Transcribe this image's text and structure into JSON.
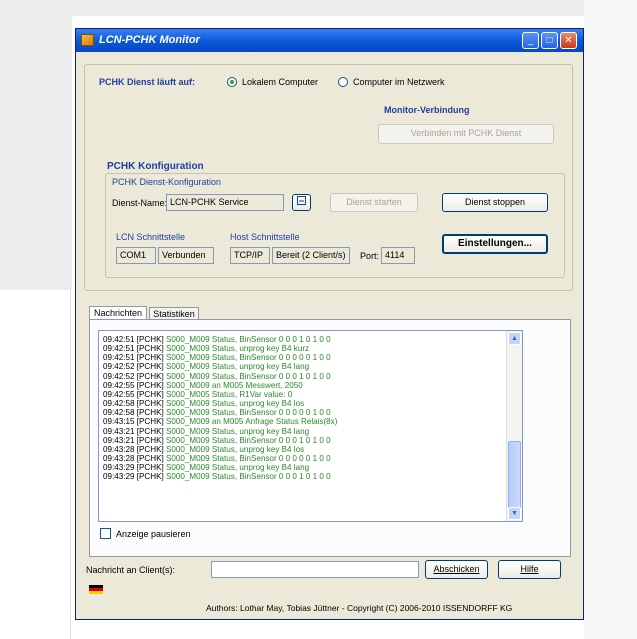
{
  "window": {
    "title": "LCN-PCHK Monitor",
    "minimize_glyph": "_",
    "maximize_glyph": "□",
    "close_glyph": "✕"
  },
  "service": {
    "label": "PCHK Dienst läuft auf:",
    "option_local": "Lokalem Computer",
    "option_network": "Computer im Netzwerk",
    "selected": "Lokalem Computer"
  },
  "monitor": {
    "title": "Monitor-Verbindung",
    "connect_button": "Verbinden mit PCHK Dienst"
  },
  "config": {
    "title": "PCHK Konfiguration",
    "subgroup_label": "PCHK Dienst-Konfiguration",
    "service_name_label": "Dienst-Name:",
    "service_name_value": "LCN-PCHK Service",
    "start_button": "Dienst starten",
    "stop_button": "Dienst stoppen",
    "lcn_label": "LCN Schnittstelle",
    "lcn_port": "COM1",
    "lcn_status": "Verbunden",
    "host_label": "Host Schnittstelle",
    "host_protocol": "TCP/IP",
    "host_status": "Bereit (2 Client/s)",
    "port_label": "Port:",
    "port_value": "4114",
    "settings_button": "Einstellungen..."
  },
  "tabs": [
    {
      "label": "Nachrichten",
      "active": true
    },
    {
      "label": "Statistiken",
      "active": false
    }
  ],
  "log": [
    {
      "time": "09:42:51 [PCHK]",
      "msg": "S000_M009 Status, BinSensor 0 0 0 1  0 1 0 0"
    },
    {
      "time": "09:42:51 [PCHK]",
      "msg": "S000_M009 Status, unprog key B4 kurz"
    },
    {
      "time": "09:42:51 [PCHK]",
      "msg": "S000_M009 Status, BinSensor 0 0 0 0  0 1 0 0"
    },
    {
      "time": "09:42:52 [PCHK]",
      "msg": "S000_M009 Status, unprog key B4 lang"
    },
    {
      "time": "09:42:52 [PCHK]",
      "msg": "S000_M009 Status, BinSensor 0 0 0 1  0 1 0 0"
    },
    {
      "time": "09:42:55 [PCHK]",
      "msg": "S000_M009 an M005 Messwert, 2050"
    },
    {
      "time": "09:42:55 [PCHK]",
      "msg": "S000_M005 Status, R1Var value: 0"
    },
    {
      "time": "09:42:58 [PCHK]",
      "msg": "S000_M009 Status, unprog key B4 los"
    },
    {
      "time": "09:42:58 [PCHK]",
      "msg": "S000_M009 Status, BinSensor 0 0 0 0  0 1 0 0"
    },
    {
      "time": "09:43:15 [PCHK]",
      "msg": "S000_M009 an M005 Anfrage Status Relais(8x)"
    },
    {
      "time": "09:43:21 [PCHK]",
      "msg": "S000_M009 Status, unprog key B4 lang"
    },
    {
      "time": "09:43:21 [PCHK]",
      "msg": "S000_M009 Status, BinSensor 0 0 0 1  0 1 0 0"
    },
    {
      "time": "09:43:28 [PCHK]",
      "msg": "S000_M009 Status, unprog key B4 los"
    },
    {
      "time": "09:43:28 [PCHK]",
      "msg": "S000_M009 Status, BinSensor 0 0 0 0  0 1 0 0"
    },
    {
      "time": "09:43:29 [PCHK]",
      "msg": "S000_M009 Status, unprog key B4 lang"
    },
    {
      "time": "09:43:29 [PCHK]",
      "msg": "S000_M009 Status, BinSensor 0 0 0 1  0 1 0 0"
    }
  ],
  "pause_label": "Anzeige pausieren",
  "message": {
    "label": "Nachricht an Client(s):",
    "value": "",
    "send_button": "Abschicken",
    "help_button": "Hilfe"
  },
  "footer": "Authors: Lothar May, Tobias Jüttner - Copyright (C) 2006-2010 ISSENDORFF KG",
  "colors": {
    "titlebar": "#0a56d8",
    "heading": "#1f3f9f",
    "log_message": "#2a8a2a",
    "window_bg": "#ece9d8"
  }
}
